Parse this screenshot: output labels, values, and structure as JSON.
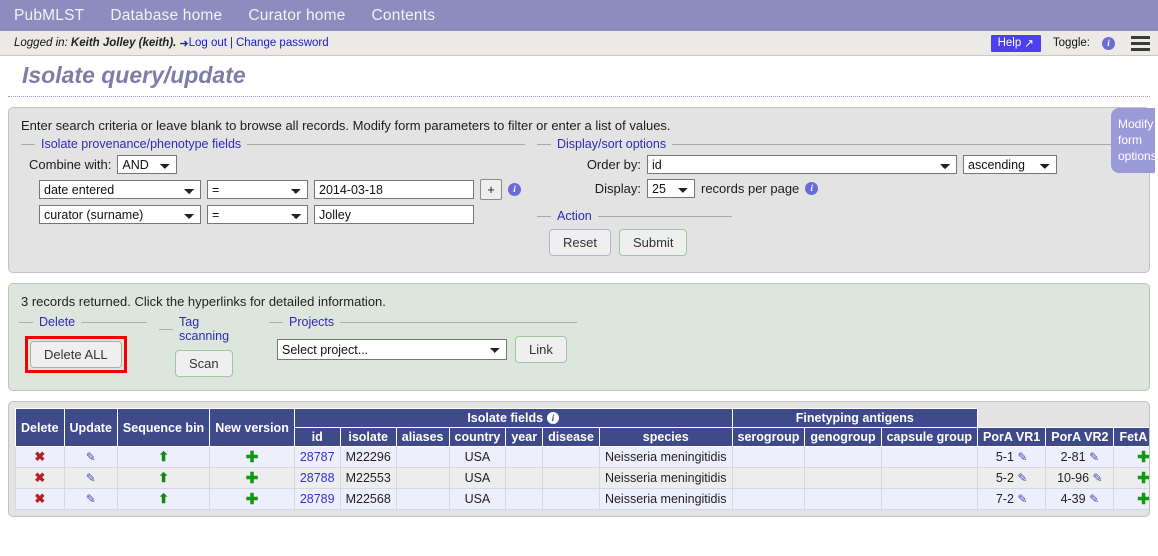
{
  "nav": {
    "items": [
      {
        "label": "PubMLST",
        "name": "nav-pubmlst"
      },
      {
        "label": "Database home",
        "name": "nav-database-home"
      },
      {
        "label": "Curator home",
        "name": "nav-curator-home"
      },
      {
        "label": "Contents",
        "name": "nav-contents"
      }
    ]
  },
  "loginbar": {
    "logged_in_prefix": "Logged in:",
    "user": "Keith Jolley (keith).",
    "logout": "Log out",
    "separator": "|",
    "change_password": "Change password",
    "help": "Help",
    "toggle_label": "Toggle:",
    "help_color": "#4b3ff0"
  },
  "page": {
    "title": "Isolate query/update"
  },
  "query_panel": {
    "intro": "Enter search criteria or leave blank to browse all records. Modify form parameters to filter or enter a list of values.",
    "provenance_legend": "Isolate provenance/phenotype fields",
    "combine_label": "Combine with:",
    "combine_value": "AND",
    "rows": [
      {
        "field": "date entered",
        "operator": "=",
        "value": "2014-03-18"
      },
      {
        "field": "curator (surname)",
        "operator": "=",
        "value": "Jolley"
      }
    ],
    "add_button": "+",
    "display_legend": "Display/sort options",
    "order_by_label": "Order by:",
    "order_by_value": "id",
    "order_dir_value": "ascending",
    "display_label": "Display:",
    "display_value": "25",
    "records_per_page": "records per page",
    "action_legend": "Action",
    "reset_label": "Reset",
    "submit_label": "Submit",
    "modify_tab": "Modify form options"
  },
  "results": {
    "summary": "3 records returned. Click the hyperlinks for detailed information.",
    "delete_legend": "Delete",
    "delete_all_label": "Delete ALL",
    "tag_legend": "Tag scanning",
    "scan_label": "Scan",
    "projects_legend": "Projects",
    "project_select_value": "Select project...",
    "link_label": "Link",
    "highlight_color": "#f40000"
  },
  "table": {
    "group_headers": [
      {
        "label": "Delete",
        "span": 1,
        "rowspan": 2
      },
      {
        "label": "Update",
        "span": 1,
        "rowspan": 2
      },
      {
        "label": "Sequence bin",
        "span": 1,
        "rowspan": 2
      },
      {
        "label": "New version",
        "span": 1,
        "rowspan": 2
      },
      {
        "label": "Isolate fields",
        "span": 8,
        "rowspan": 1,
        "info": true
      },
      {
        "label": "Finetyping antigens",
        "span": 3,
        "rowspan": 1
      }
    ],
    "sub_headers": [
      "id",
      "isolate",
      "aliases",
      "country",
      "year",
      "disease",
      "species",
      "serogroup",
      "genogroup",
      "capsule group",
      "PorA VR1",
      "PorA VR2",
      "FetA VR"
    ],
    "rows": [
      {
        "id": "28787",
        "isolate": "M22296",
        "aliases": "",
        "country": "USA",
        "year": "",
        "disease": "",
        "species": "Neisseria meningitidis",
        "serogroup": "",
        "genogroup": "",
        "capsule_group": "",
        "pora_vr1": "5-1",
        "pora_vr2": "2-81",
        "feta_vr": ""
      },
      {
        "id": "28788",
        "isolate": "M22553",
        "aliases": "",
        "country": "USA",
        "year": "",
        "disease": "",
        "species": "Neisseria meningitidis",
        "serogroup": "",
        "genogroup": "",
        "capsule_group": "",
        "pora_vr1": "5-2",
        "pora_vr2": "10-96",
        "feta_vr": ""
      },
      {
        "id": "28789",
        "isolate": "M22568",
        "aliases": "",
        "country": "USA",
        "year": "",
        "disease": "",
        "species": "Neisseria meningitidis",
        "serogroup": "",
        "genogroup": "",
        "capsule_group": "",
        "pora_vr1": "7-2",
        "pora_vr2": "4-39",
        "feta_vr": ""
      }
    ],
    "icons": {
      "delete": "✖",
      "update": "✎",
      "sequence_bin": "⬆",
      "new_version": "✚",
      "edit": "✎",
      "add": "✚"
    }
  },
  "colors": {
    "nav_bar": "#8c8cbe",
    "panel_bg": "#e3e3e3",
    "results_bg": "#dde6dd",
    "table_header": "#3f4a8a",
    "title": "#7d7da8",
    "link": "#1a1ad0"
  }
}
